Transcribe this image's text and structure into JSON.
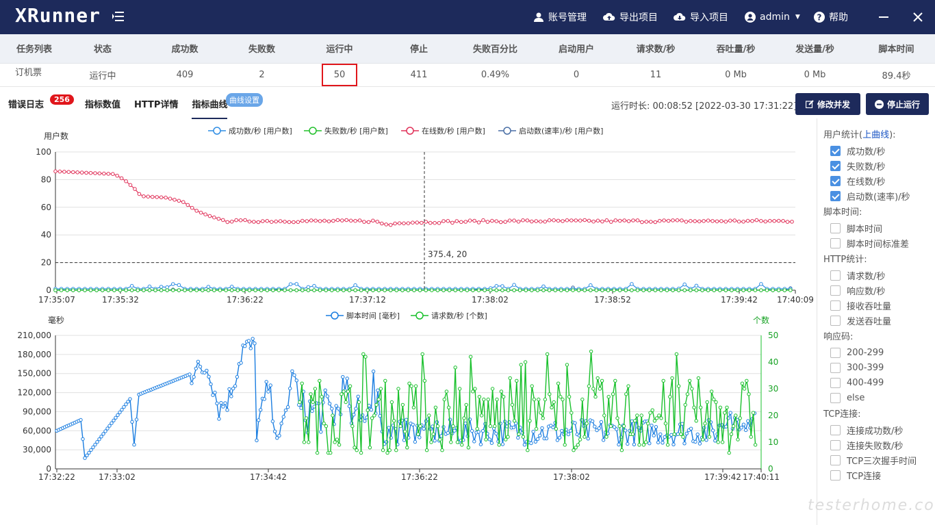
{
  "app": {
    "logo": "XRunner"
  },
  "nav": {
    "account": "账号管理",
    "export": "导出项目",
    "import": "导入项目",
    "user": "admin",
    "help": "帮助"
  },
  "table": {
    "headers": [
      "任务列表",
      "状态",
      "成功数",
      "失败数",
      "运行中",
      "停止",
      "失败百分比",
      "启动用户",
      "请求数/秒",
      "吞吐量/秒",
      "发送量/秒",
      "脚本时间"
    ],
    "row": [
      "订机票",
      "运行中",
      "409",
      "2",
      "50",
      "411",
      "0.49%",
      "0",
      "11",
      "0 Mb",
      "0 Mb",
      "89.4秒"
    ]
  },
  "tabs": {
    "error_log": "错误日志",
    "error_count": "256",
    "metrics_value": "指标数值",
    "http_detail": "HTTP详情",
    "metrics_curve": "指标曲线",
    "curve_settings": "曲线设置"
  },
  "status": {
    "runtime": "运行时长: 00:08:52  [2022-03-30 17:31:22]"
  },
  "actions": {
    "modify": "修改并发",
    "stop": "停止运行"
  },
  "sidebar": {
    "user_stats_prefix": "用户统计(",
    "user_stats_link": "上曲线",
    "user_stats_suffix": "):",
    "user_items": [
      {
        "label": "成功数/秒",
        "checked": true
      },
      {
        "label": "失败数/秒",
        "checked": true
      },
      {
        "label": "在线数/秒",
        "checked": true
      },
      {
        "label": "启动数(速率)/秒",
        "checked": true
      }
    ],
    "script_title": "脚本时间:",
    "script_items": [
      {
        "label": "脚本时间",
        "checked": false
      },
      {
        "label": "脚本时间标准差",
        "checked": false
      }
    ],
    "http_title": "HTTP统计:",
    "http_items": [
      {
        "label": "请求数/秒",
        "checked": false
      },
      {
        "label": "响应数/秒",
        "checked": false
      },
      {
        "label": "接收吞吐量",
        "checked": false
      },
      {
        "label": "发送吞吐量",
        "checked": false
      }
    ],
    "code_title": "响应码:",
    "code_items": [
      {
        "label": "200-299",
        "checked": false
      },
      {
        "label": "300-399",
        "checked": false
      },
      {
        "label": "400-499",
        "checked": false
      },
      {
        "label": "else",
        "checked": false
      }
    ],
    "tcp_title": "TCP连接:",
    "tcp_items": [
      {
        "label": "连接成功数/秒",
        "checked": false
      },
      {
        "label": "连接失败数/秒",
        "checked": false
      },
      {
        "label": "TCP三次握手时间",
        "checked": false
      },
      {
        "label": "TCP连接",
        "checked": false
      }
    ]
  },
  "watermark": "testerhome.com",
  "chart_data": [
    {
      "type": "line",
      "ylabel": "用户数",
      "ylim": [
        0,
        100
      ],
      "yticks": [
        0,
        20,
        40,
        60,
        80,
        100
      ],
      "xticks": [
        "17:35:07",
        "17:35:32",
        "17:36:22",
        "17:37:12",
        "17:38:02",
        "17:38:52",
        "17:39:42",
        "17:40:09"
      ],
      "x_range_seconds": [
        0,
        302
      ],
      "series": [
        {
          "name": "成功数/秒 [用户数]",
          "color": "#2f8de4",
          "base": 1
        },
        {
          "name": "失败数/秒 [用户数]",
          "color": "#22c02c",
          "base": 0
        },
        {
          "name": "在线数/秒 [用户数]",
          "color": "#e03058",
          "points": [
            [
              0,
              86
            ],
            [
              12,
              85
            ],
            [
              24,
              84
            ],
            [
              28,
              80
            ],
            [
              32,
              74
            ],
            [
              35,
              68
            ],
            [
              45,
              67
            ],
            [
              52,
              64
            ],
            [
              58,
              57
            ],
            [
              64,
              53
            ],
            [
              70,
              50
            ],
            [
              130,
              50
            ],
            [
              136,
              47
            ],
            [
              140,
              49
            ],
            [
              180,
              50
            ],
            [
              302,
              50
            ]
          ]
        },
        {
          "name": "启动数(速率)/秒 [用户数]",
          "color": "#4a6fa5",
          "base": 0
        }
      ],
      "crosshair": {
        "x": 375.4,
        "y": 20,
        "label": "375.4, 20"
      }
    },
    {
      "type": "line",
      "ylabel": "毫秒",
      "ylabel_right": "个数",
      "ylim": [
        0,
        210000
      ],
      "ylim_right": [
        0,
        50
      ],
      "yticks": [
        0,
        30000,
        60000,
        90000,
        120000,
        150000,
        180000,
        210000
      ],
      "yticks_right": [
        0,
        10,
        20,
        30,
        40,
        50
      ],
      "xticks": [
        "17:32:22",
        "17:33:02",
        "17:34:42",
        "17:36:22",
        "17:38:02",
        "17:39:42",
        "17:40:11"
      ],
      "series": [
        {
          "name": "脚本时间 [毫秒]",
          "color": "#1a7de0",
          "axis": "left"
        },
        {
          "name": "请求数/秒 [个数]",
          "color": "#19c02c",
          "axis": "right"
        }
      ]
    }
  ]
}
